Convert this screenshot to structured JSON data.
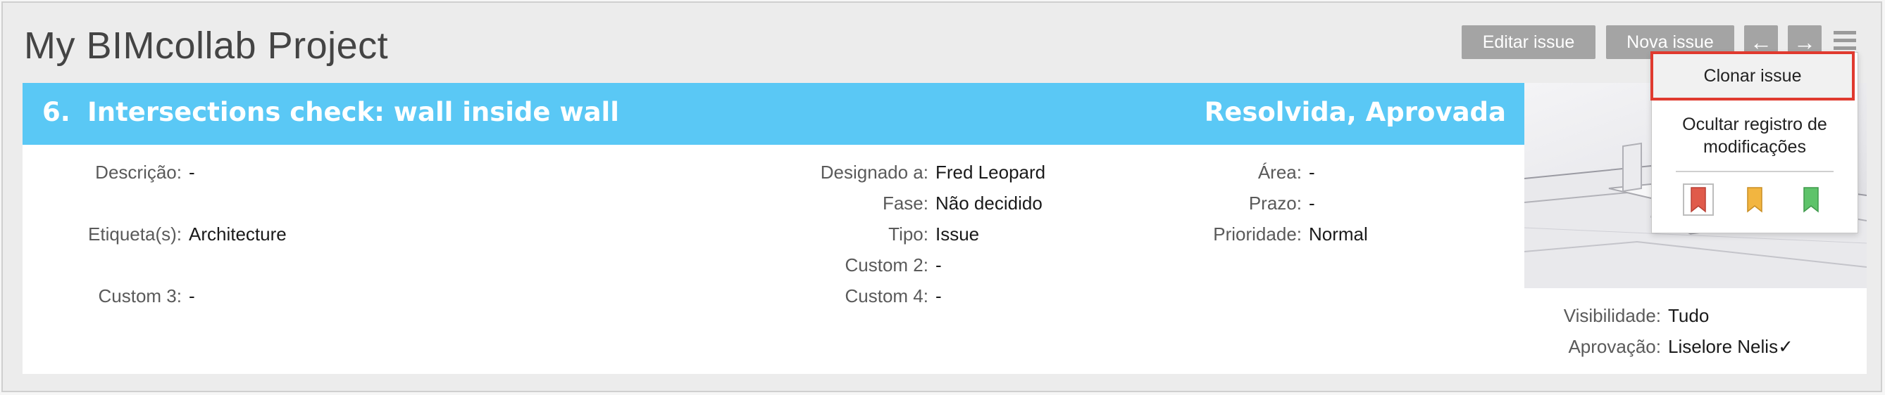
{
  "header": {
    "title": "My BIMcollab Project",
    "edit_button": "Editar issue",
    "new_button": "Nova issue",
    "prev_arrow": "←",
    "next_arrow": "→"
  },
  "issue": {
    "number": "6.",
    "title": "Intersections check: wall inside wall",
    "status": "Resolvida, Aprovada",
    "banner_color": "#5ac8f5"
  },
  "fields": {
    "descricao": {
      "label": "Descrição:",
      "value": "-"
    },
    "etiquetas": {
      "label": "Etiqueta(s):",
      "value": "Architecture"
    },
    "custom3": {
      "label": "Custom 3:",
      "value": "-"
    },
    "designado": {
      "label": "Designado a:",
      "value": "Fred Leopard"
    },
    "fase": {
      "label": "Fase:",
      "value": "Não decidido"
    },
    "tipo": {
      "label": "Tipo:",
      "value": "Issue"
    },
    "custom2": {
      "label": "Custom 2:",
      "value": "-"
    },
    "custom4": {
      "label": "Custom 4:",
      "value": "-"
    },
    "area": {
      "label": "Área:",
      "value": "-"
    },
    "prazo": {
      "label": "Prazo:",
      "value": "-"
    },
    "prioridade": {
      "label": "Prioridade:",
      "value": "Normal"
    },
    "visibilidade": {
      "label": "Visibilidade:",
      "value": "Tudo"
    },
    "aprovacao": {
      "label": "Aprovação:",
      "value": "Liselore Nelis✓"
    }
  },
  "menu": {
    "clone": "Clonar issue",
    "hide_log": "Ocultar registro de modificações",
    "flags": [
      {
        "name": "red-flag-icon",
        "color": "#e05a4a"
      },
      {
        "name": "yellow-flag-icon",
        "color": "#f2b540"
      },
      {
        "name": "green-flag-icon",
        "color": "#5ec36a"
      }
    ],
    "highlight_color": "#e03a2f"
  }
}
